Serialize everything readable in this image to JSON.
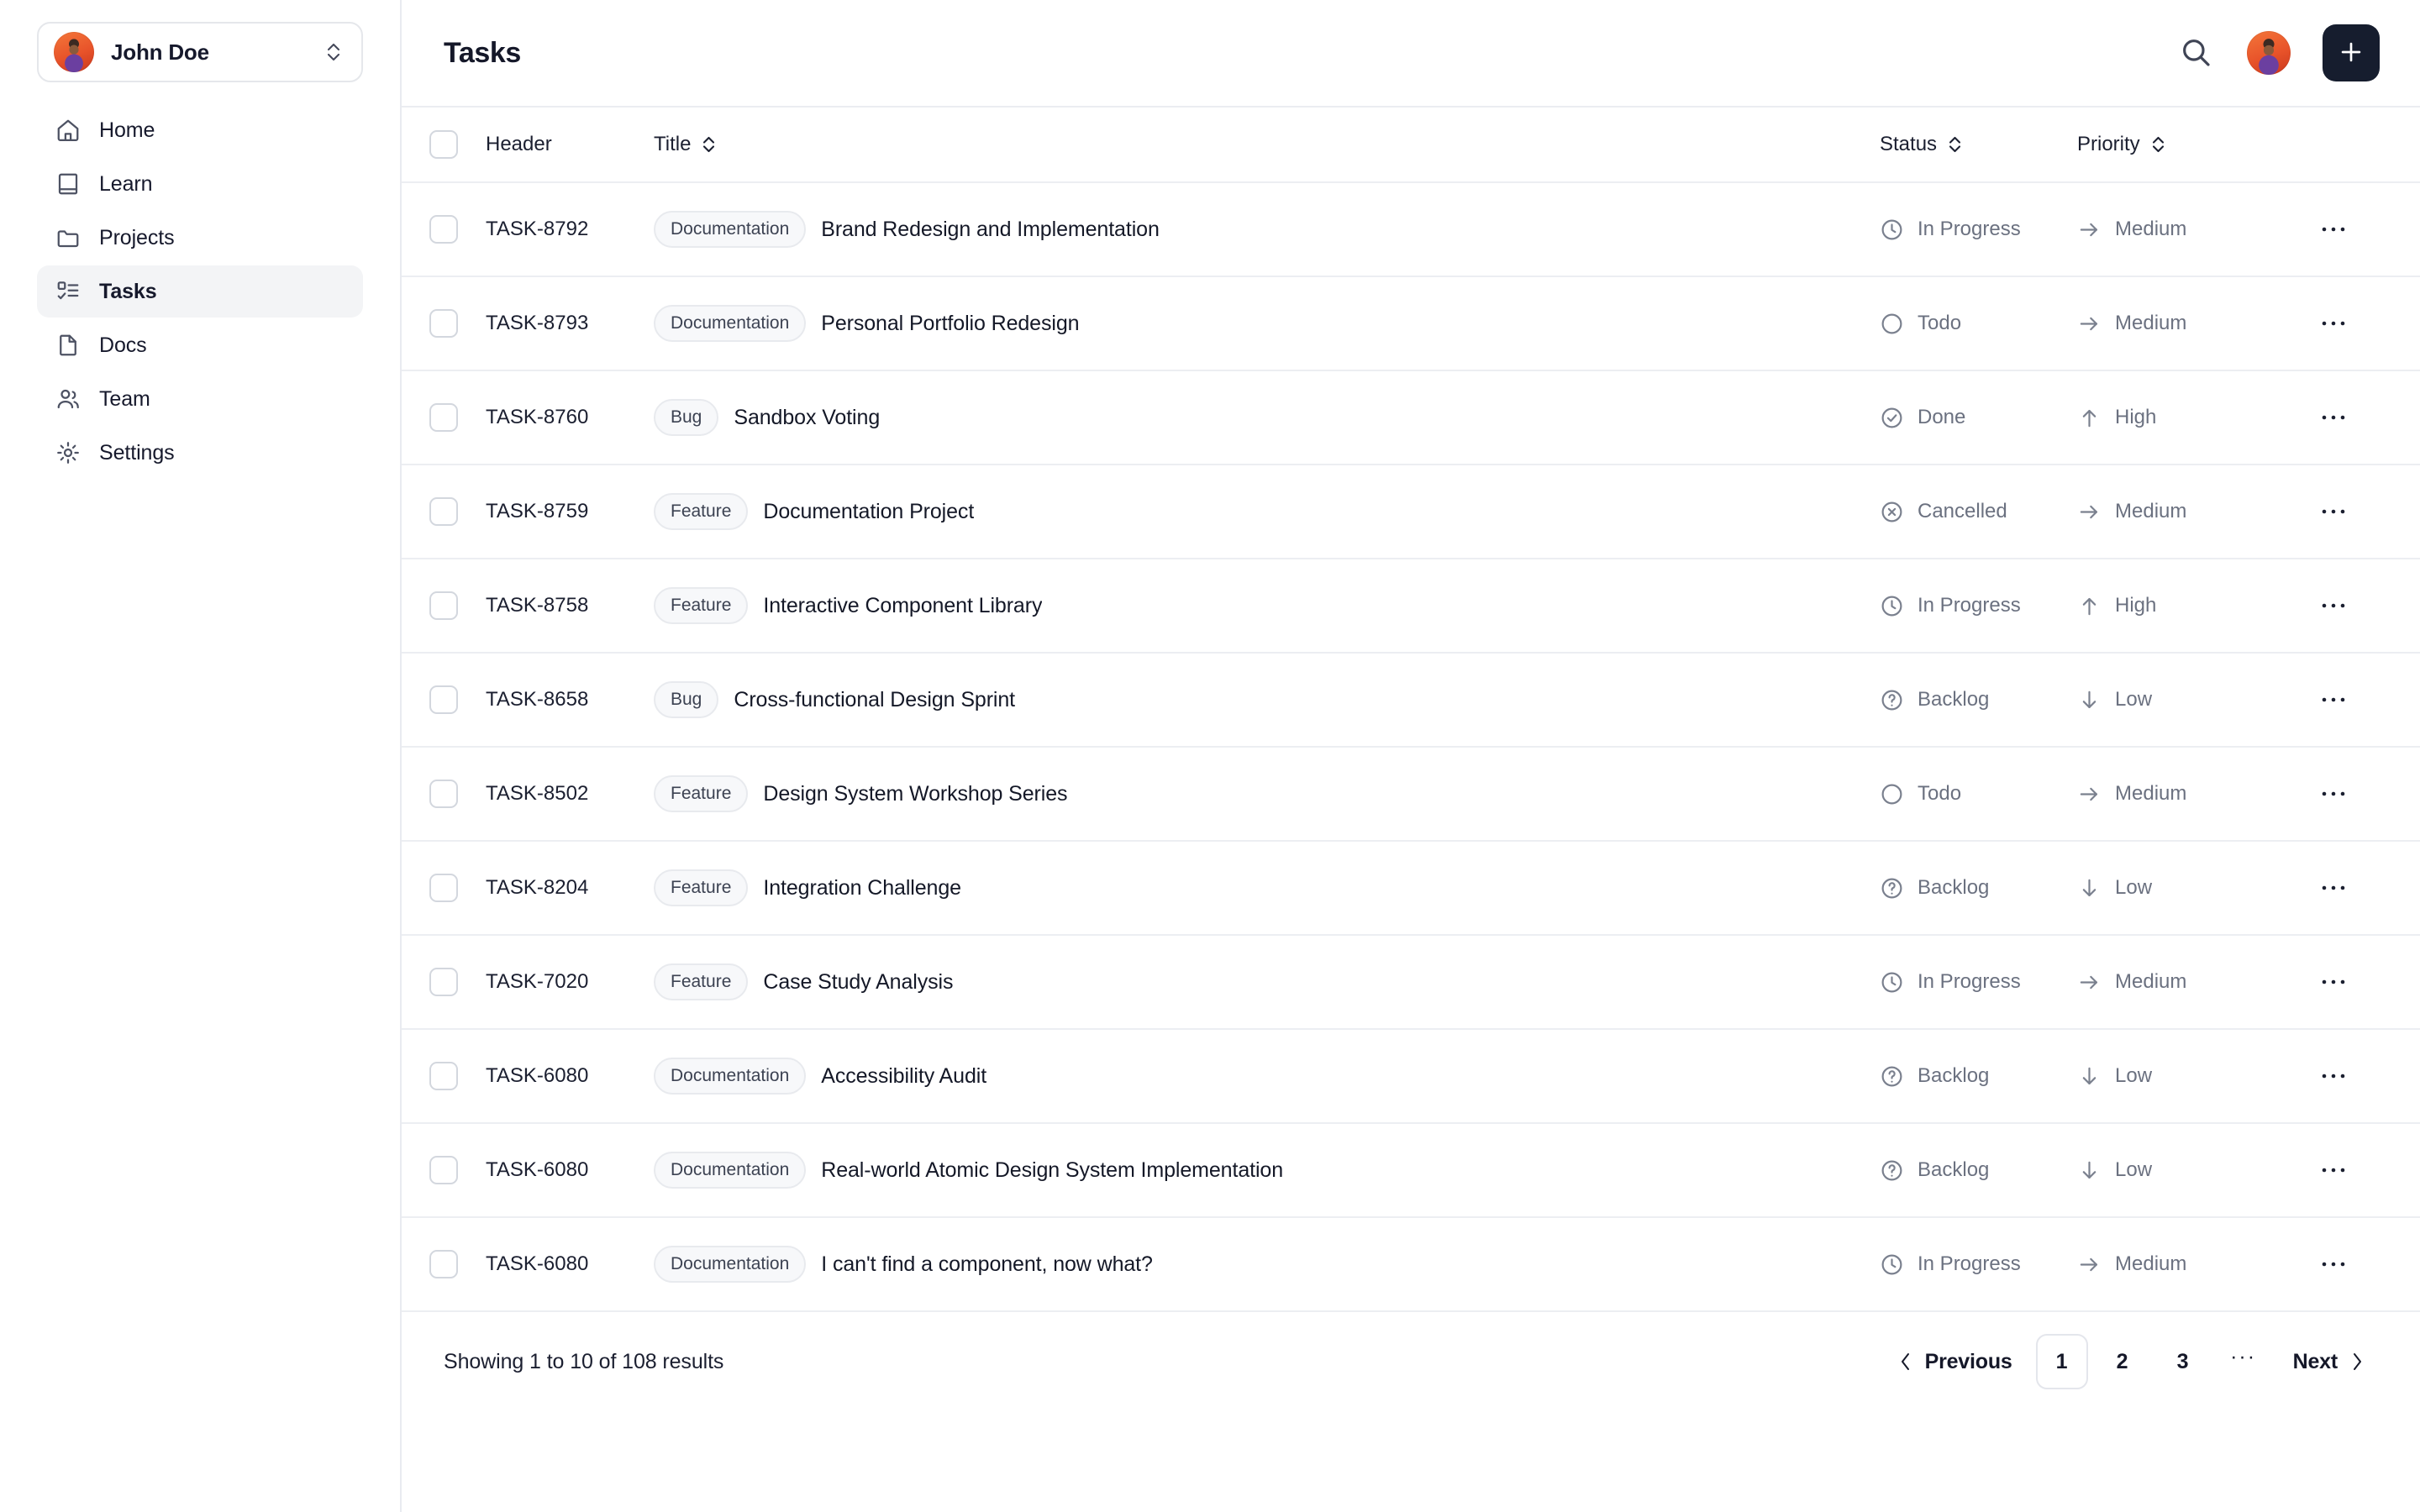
{
  "sidebar": {
    "user": {
      "name": "John Doe",
      "avatar_icon": "user-avatar",
      "toggle_icon": "chevron-up-down-icon"
    },
    "items": [
      {
        "label": "Home",
        "icon": "home-icon",
        "active": false
      },
      {
        "label": "Learn",
        "icon": "book-icon",
        "active": false
      },
      {
        "label": "Projects",
        "icon": "folder-icon",
        "active": false
      },
      {
        "label": "Tasks",
        "icon": "list-check-icon",
        "active": true
      },
      {
        "label": "Docs",
        "icon": "file-icon",
        "active": false
      },
      {
        "label": "Team",
        "icon": "users-icon",
        "active": false
      },
      {
        "label": "Settings",
        "icon": "gear-icon",
        "active": false
      }
    ]
  },
  "topbar": {
    "title": "Tasks",
    "search_icon": "search-icon",
    "avatar_icon": "user-avatar",
    "add_icon": "plus-icon"
  },
  "table": {
    "columns": {
      "select_all": "",
      "header": "Header",
      "title": "Title",
      "status": "Status",
      "priority": "Priority",
      "actions": ""
    },
    "sortable": [
      "title",
      "status",
      "priority"
    ],
    "sort_icon": "chevron-up-down-icon",
    "row_action_icon": "ellipsis-icon",
    "rows": [
      {
        "header": "TASK-8792",
        "badge": "Documentation",
        "title": "Brand Redesign and Implementation",
        "status": "In Progress",
        "status_icon": "clock-icon",
        "priority": "Medium",
        "priority_icon": "arrow-right-icon"
      },
      {
        "header": "TASK-8793",
        "badge": "Documentation",
        "title": "Personal Portfolio Redesign",
        "status": "Todo",
        "status_icon": "circle-icon",
        "priority": "Medium",
        "priority_icon": "arrow-right-icon"
      },
      {
        "header": "TASK-8760",
        "badge": "Bug",
        "title": "Sandbox Voting",
        "status": "Done",
        "status_icon": "check-circle-icon",
        "priority": "High",
        "priority_icon": "arrow-up-icon"
      },
      {
        "header": "TASK-8759",
        "badge": "Feature",
        "title": "Documentation Project",
        "status": "Cancelled",
        "status_icon": "x-circle-icon",
        "priority": "Medium",
        "priority_icon": "arrow-right-icon"
      },
      {
        "header": "TASK-8758",
        "badge": "Feature",
        "title": "Interactive Component Library",
        "status": "In Progress",
        "status_icon": "clock-icon",
        "priority": "High",
        "priority_icon": "arrow-up-icon"
      },
      {
        "header": "TASK-8658",
        "badge": "Bug",
        "title": "Cross-functional Design Sprint",
        "status": "Backlog",
        "status_icon": "question-circle-icon",
        "priority": "Low",
        "priority_icon": "arrow-down-icon"
      },
      {
        "header": "TASK-8502",
        "badge": "Feature",
        "title": "Design System Workshop Series",
        "status": "Todo",
        "status_icon": "circle-icon",
        "priority": "Medium",
        "priority_icon": "arrow-right-icon"
      },
      {
        "header": "TASK-8204",
        "badge": "Feature",
        "title": "Integration Challenge",
        "status": "Backlog",
        "status_icon": "question-circle-icon",
        "priority": "Low",
        "priority_icon": "arrow-down-icon"
      },
      {
        "header": "TASK-7020",
        "badge": "Feature",
        "title": "Case Study Analysis",
        "status": "In Progress",
        "status_icon": "clock-icon",
        "priority": "Medium",
        "priority_icon": "arrow-right-icon"
      },
      {
        "header": "TASK-6080",
        "badge": "Documentation",
        "title": "Accessibility Audit",
        "status": "Backlog",
        "status_icon": "question-circle-icon",
        "priority": "Low",
        "priority_icon": "arrow-down-icon"
      },
      {
        "header": "TASK-6080",
        "badge": "Documentation",
        "title": "Real-world Atomic Design System Implementation",
        "status": "Backlog",
        "status_icon": "question-circle-icon",
        "priority": "Low",
        "priority_icon": "arrow-down-icon"
      },
      {
        "header": "TASK-6080",
        "badge": "Documentation",
        "title": "I can't find a component, now what?",
        "status": "In Progress",
        "status_icon": "clock-icon",
        "priority": "Medium",
        "priority_icon": "arrow-right-icon"
      }
    ]
  },
  "footer": {
    "results_text": "Showing 1 to 10 of 108 results",
    "previous_label": "Previous",
    "next_label": "Next",
    "pages": [
      "1",
      "2",
      "3"
    ],
    "ellipsis": "···",
    "current_page": "1",
    "prev_icon": "chevron-left-icon",
    "next_icon": "chevron-right-icon"
  },
  "colors": {
    "accent_dark": "#161d2e",
    "border": "#eceef2",
    "active_nav_bg": "#f3f4f6",
    "muted_text": "#6b7180"
  }
}
